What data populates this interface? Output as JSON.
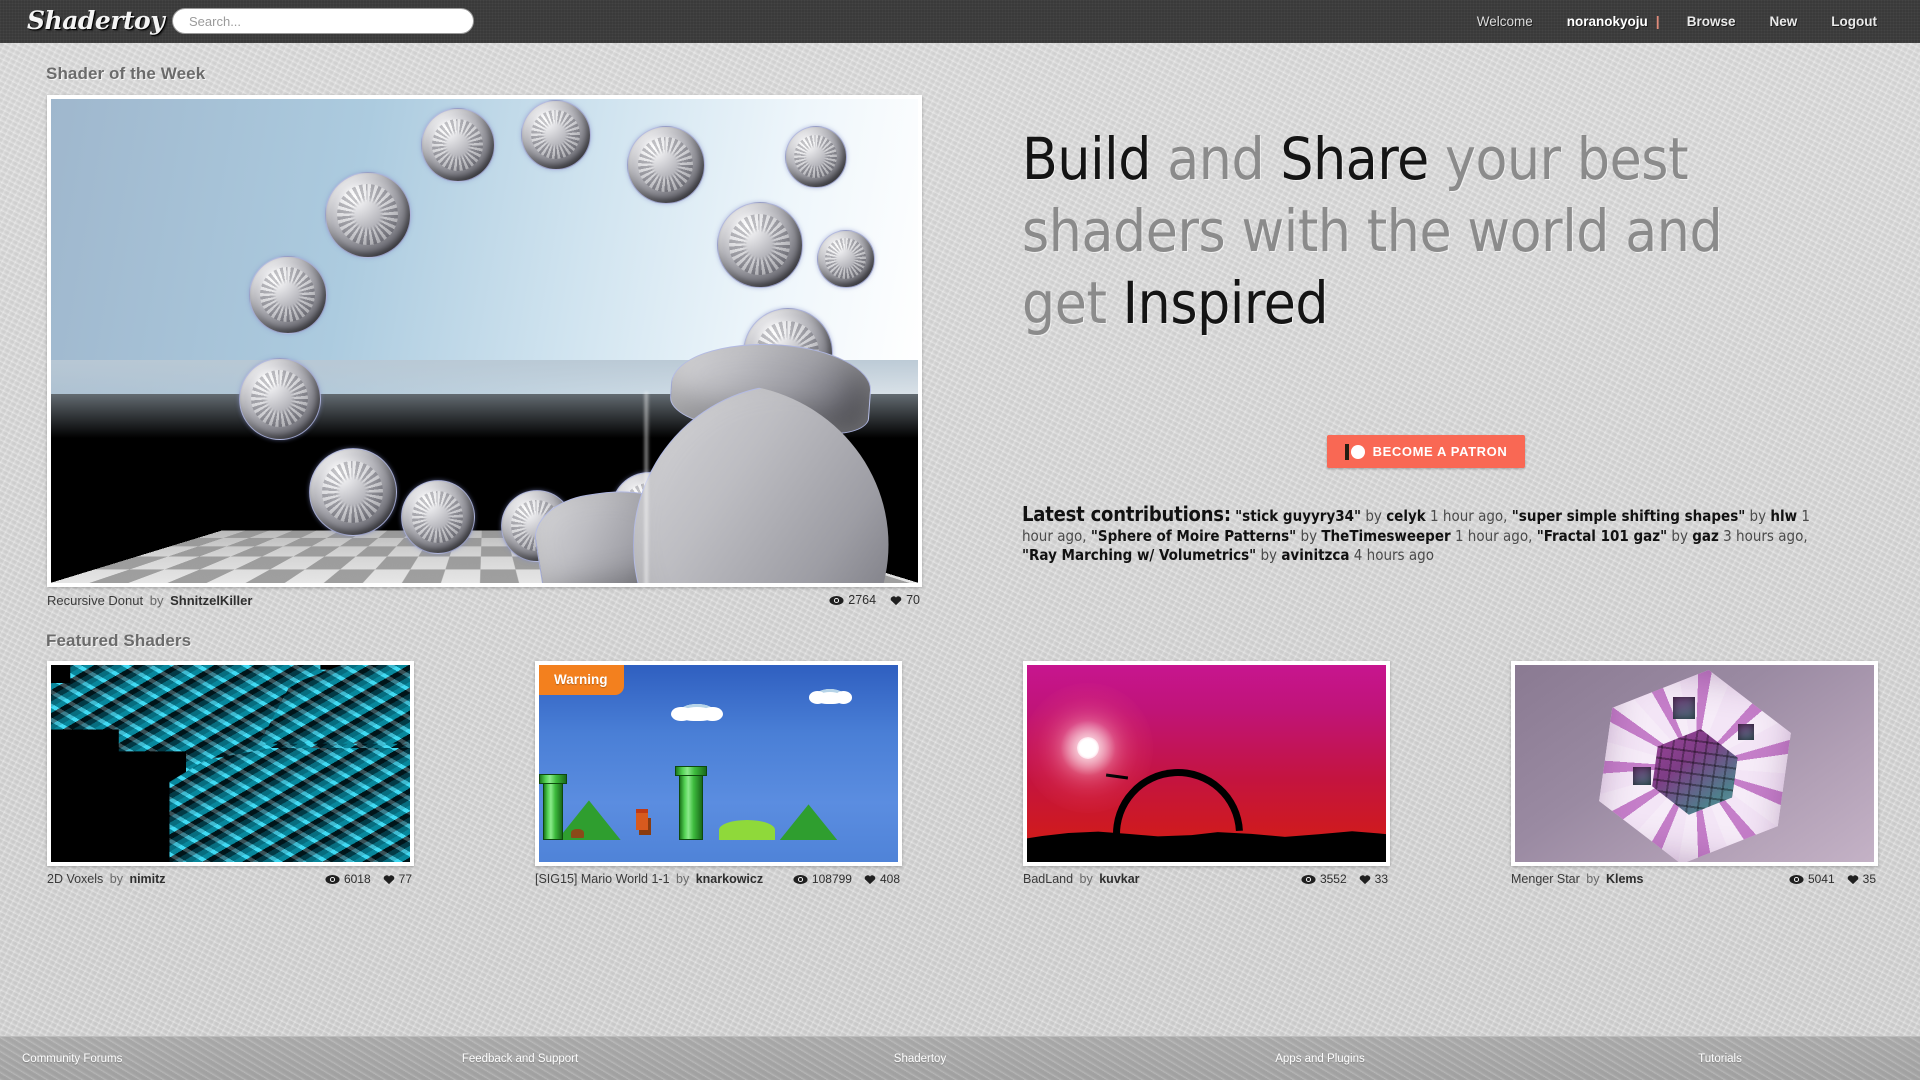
{
  "header": {
    "logo": "Shadertoy",
    "search": {
      "placeholder": "Search...",
      "value": ""
    },
    "nav": {
      "welcome": "Welcome",
      "username": "noranokyoju",
      "separator": "|",
      "browse": "Browse",
      "new": "New",
      "logout": "Logout"
    }
  },
  "sections": {
    "shader_of_the_week": "Shader of the Week",
    "featured_shaders": "Featured Shaders"
  },
  "shader_of_the_week": {
    "title": "Recursive Donut",
    "by": "by",
    "author": "ShnitzelKiller",
    "views": "2764",
    "likes": "70"
  },
  "hero": {
    "headline_parts": [
      {
        "text": "Build ",
        "highlight": true
      },
      {
        "text": "and ",
        "highlight": false
      },
      {
        "text": "Share ",
        "highlight": true
      },
      {
        "text": "your best shaders with the world and get ",
        "highlight": false
      },
      {
        "text": "Inspired",
        "highlight": true
      }
    ],
    "patron_button": "BECOME A PATRON",
    "patron_color": "#f96854"
  },
  "latest_contributions": {
    "label": "Latest contributions:",
    "by": "by",
    "items": [
      {
        "name": "\"stick guyyry34\"",
        "author": "celyk",
        "time": "1 hour ago"
      },
      {
        "name": "\"super simple shifting shapes\"",
        "author": "hlw",
        "time": "1 hour ago"
      },
      {
        "name": "\"Sphere of Moire Patterns\"",
        "author": "TheTimesweeper",
        "time": "1 hour ago"
      },
      {
        "name": "\"Fractal 101 gaz\"",
        "author": "gaz",
        "time": "3 hours ago"
      },
      {
        "name": "\"Ray Marching w/ Volumetrics\"",
        "author": "avinitzca",
        "time": "4 hours ago"
      }
    ]
  },
  "featured": [
    {
      "title": "2D Voxels",
      "by": "by",
      "author": "nimitz",
      "views": "6018",
      "likes": "77",
      "badge": null,
      "art": "voxels"
    },
    {
      "title": "[SIG15] Mario World 1-1",
      "by": "by",
      "author": "knarkowicz",
      "views": "108799",
      "likes": "408",
      "badge": "Warning",
      "art": "mario"
    },
    {
      "title": "BadLand",
      "by": "by",
      "author": "kuvkar",
      "views": "3552",
      "likes": "33",
      "badge": null,
      "art": "badland"
    },
    {
      "title": "Menger Star",
      "by": "by",
      "author": "Klems",
      "views": "5041",
      "likes": "35",
      "badge": null,
      "art": "menger"
    }
  ],
  "footer": {
    "links": [
      "Community Forums",
      "Feedback and Support",
      "Shadertoy",
      "Apps and Plugins",
      "Tutorials"
    ]
  },
  "icons": {
    "eye": "eye-icon",
    "heart": "heart-icon",
    "search": "search-icon",
    "patreon": "patreon-logo-icon"
  },
  "colors": {
    "header_bg": "#3a3a3a",
    "page_bg": "#d2d2d2",
    "accent_orange": "#f3801e",
    "patron": "#f96854",
    "footer_bg": "#a9a9a9"
  }
}
